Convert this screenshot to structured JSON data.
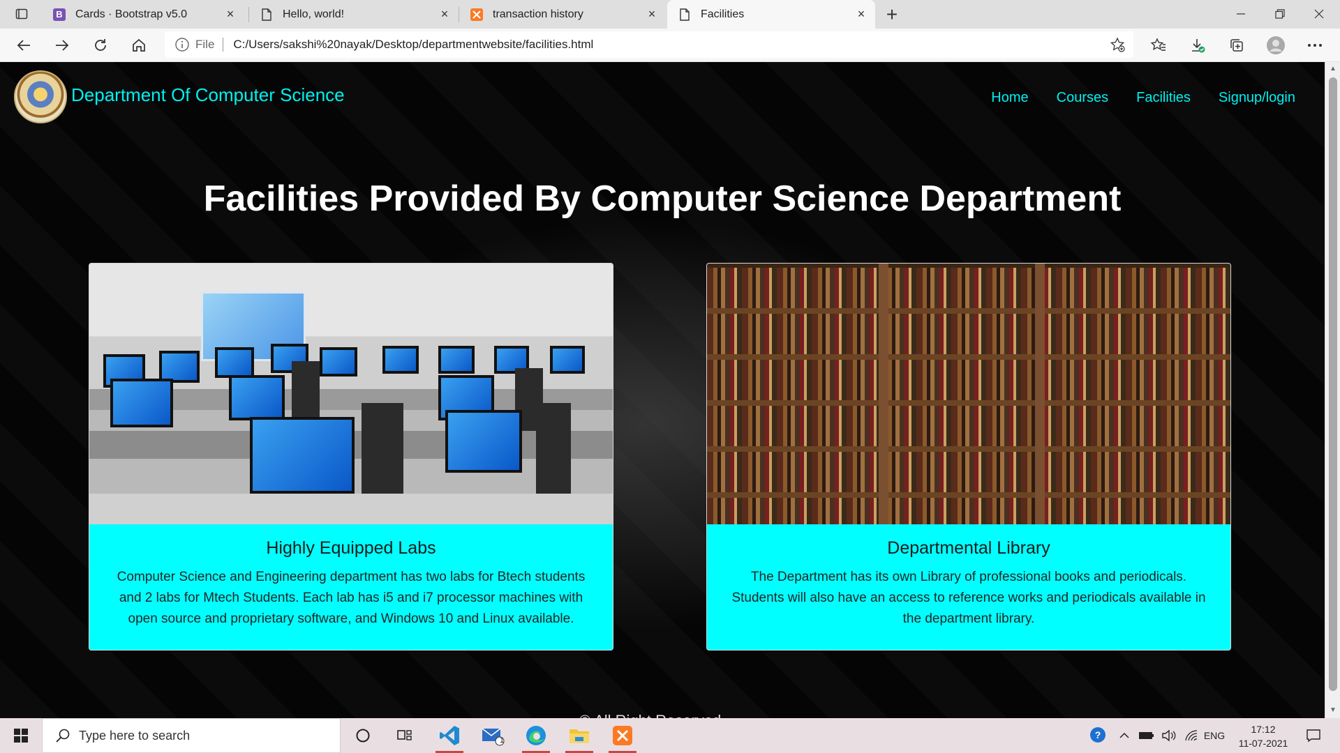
{
  "browser": {
    "tabs": [
      {
        "title": "Cards · Bootstrap v5.0",
        "favicon": "bootstrap-icon",
        "favicon_color": "#7952b3",
        "favicon_text": "B",
        "active": false
      },
      {
        "title": "Hello, world!",
        "favicon": "page-icon",
        "active": false
      },
      {
        "title": "transaction history",
        "favicon": "xampp-icon",
        "favicon_color": "#fb7a24",
        "active": false
      },
      {
        "title": "Facilities",
        "favicon": "page-icon",
        "active": true
      }
    ],
    "address": {
      "scheme": "File",
      "url": "C:/Users/sakshi%20nayak/Desktop/departmentwebsite/facilities.html"
    }
  },
  "site": {
    "brand": "Department Of Computer Science",
    "nav": [
      "Home",
      "Courses",
      "Facilities",
      "Signup/login"
    ],
    "heading": "Facilities Provided By Computer Science Department",
    "cards": [
      {
        "title": "Highly Equipped Labs",
        "text": "Computer Science and Engineering department has two labs for Btech students and 2 labs for Mtech Students. Each lab has i5 and i7 processor machines with open source and proprietary software, and Windows 10 and Linux available.",
        "image": "computer-lab-photo"
      },
      {
        "title": "Departmental Library",
        "text": "The Department has its own Library of professional books and periodicals. Students will also have an access to reference works and periodicals available in the department library.",
        "image": "library-bookshelves-photo"
      }
    ],
    "footer_partial": "© All Right Reserved"
  },
  "colors": {
    "accent": "#00f0f0",
    "card_bg": "#00ffff"
  },
  "taskbar": {
    "search_placeholder": "Type here to search",
    "apps": [
      "cortana-icon",
      "task-view-icon",
      "vscode-icon",
      "mail-icon",
      "edge-icon",
      "file-explorer-icon",
      "xampp-icon"
    ],
    "mail_badge": "1",
    "language": "ENG",
    "time": "17:12",
    "date": "11-07-2021"
  }
}
